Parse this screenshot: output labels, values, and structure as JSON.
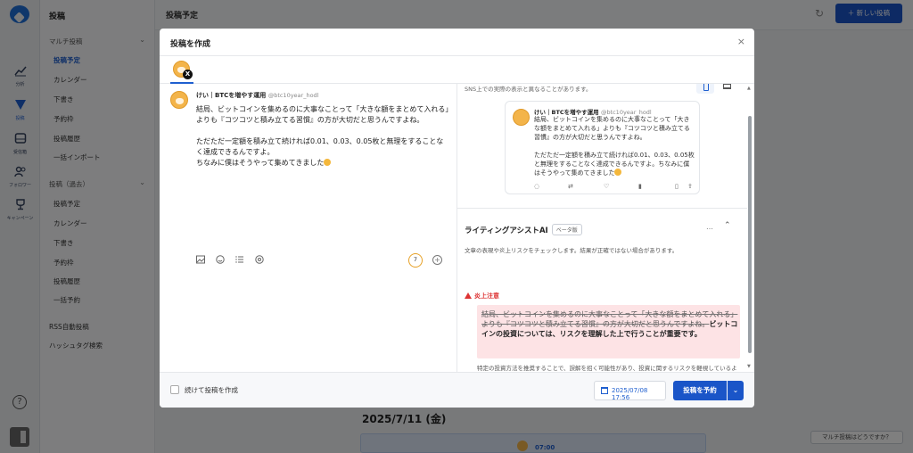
{
  "rail": {
    "items": [
      {
        "label": "分析",
        "icon": "chart-icon"
      },
      {
        "label": "投稿",
        "icon": "send-icon"
      },
      {
        "label": "受信箱",
        "icon": "inbox-icon"
      },
      {
        "label": "フォロワー",
        "icon": "users-icon"
      },
      {
        "label": "キャンペーン",
        "icon": "trophy-icon"
      }
    ],
    "help": "?"
  },
  "subnav": {
    "header": "投稿",
    "section_multi": "マルチ投稿",
    "multi_items": [
      "投稿予定",
      "カレンダー",
      "下書き",
      "予約枠",
      "投稿履歴",
      "一括インポート"
    ],
    "section_legacy": "投稿（過去）",
    "legacy_items": [
      "投稿予定",
      "カレンダー",
      "下書き",
      "予約枠",
      "投稿履歴",
      "一括予約"
    ],
    "rss": "RSS自動投稿",
    "hashtag": "ハッシュタグ検索"
  },
  "topbar": {
    "title": "投稿予定",
    "new_post": "＋ 新しい投稿"
  },
  "background": {
    "date_heading": "2025/7/11 (金)",
    "card_time": "07:00",
    "feedback": "マルチ投稿はどうですか？"
  },
  "modal": {
    "title": "投稿を作成",
    "close": "×",
    "account": {
      "name": "けい｜BTCを増やす運用",
      "handle": "@btc10year_hodl",
      "network_badge": "X"
    },
    "composer": {
      "paragraphs": [
        "結局、ビットコインを集めるのに大事なことって「大きな額をまとめて入れる」よりも『コツコツと積み立てる習慣』の方が大切だと思うんですよね。",
        "",
        "ただただ一定額を積み立て続ければ0.01、0.03、0.05枚と無理をすることなく達成できるんですよ。",
        "ちなみに僕はそうやって集めてきました"
      ],
      "char_counter": "7",
      "toolbar_icons": [
        "image-icon",
        "emoji-icon",
        "list-icon",
        "gif-icon"
      ]
    },
    "preview": {
      "note": "SNS上での実際の表示と異なることがあります。",
      "paragraphs": [
        "結局、ビットコインを集めるのに大事なことって「大きな額をまとめて入れる」よりも『コツコツと積み立てる習慣』の方が大切だと思うんですよね。",
        "",
        "ただただ一定額を積み立て続ければ0.01、0.03、0.05枚と無理をすることなく達成できるんですよ。ちなみに僕はそうやって集めてきました"
      ]
    },
    "assistant": {
      "title": "ライティングアシストAI",
      "beta": "ベータ版",
      "more": "…",
      "desc": "文章の表現や炎上リスクをチェックします。結果が正確ではない場合があります。",
      "warning_label": "炎上注意",
      "struck_text": "結局、ビットコインを集めるのに大事なことって「大きな額をまとめて入れる」よりも『コツコツと積み立てる習慣』の方が大切だと思うんですよね。",
      "suggested_text": "ビットコインの投資については、リスクを理解した上で行うことが重要です。",
      "note": "特定の投資方法を推奨することで、誤解を招く可能性があり、投資に関するリスクを軽視しているように受け取られるかもしれません。"
    },
    "footer": {
      "continue_label": "続けて投稿を作成",
      "datetime": "2025/07/08 17:56",
      "schedule": "投稿を予約"
    }
  },
  "colors": {
    "primary": "#1a55c8",
    "warning": "#d33333",
    "warning_bg": "#fde3e5",
    "counter_ring": "#e6a128"
  }
}
